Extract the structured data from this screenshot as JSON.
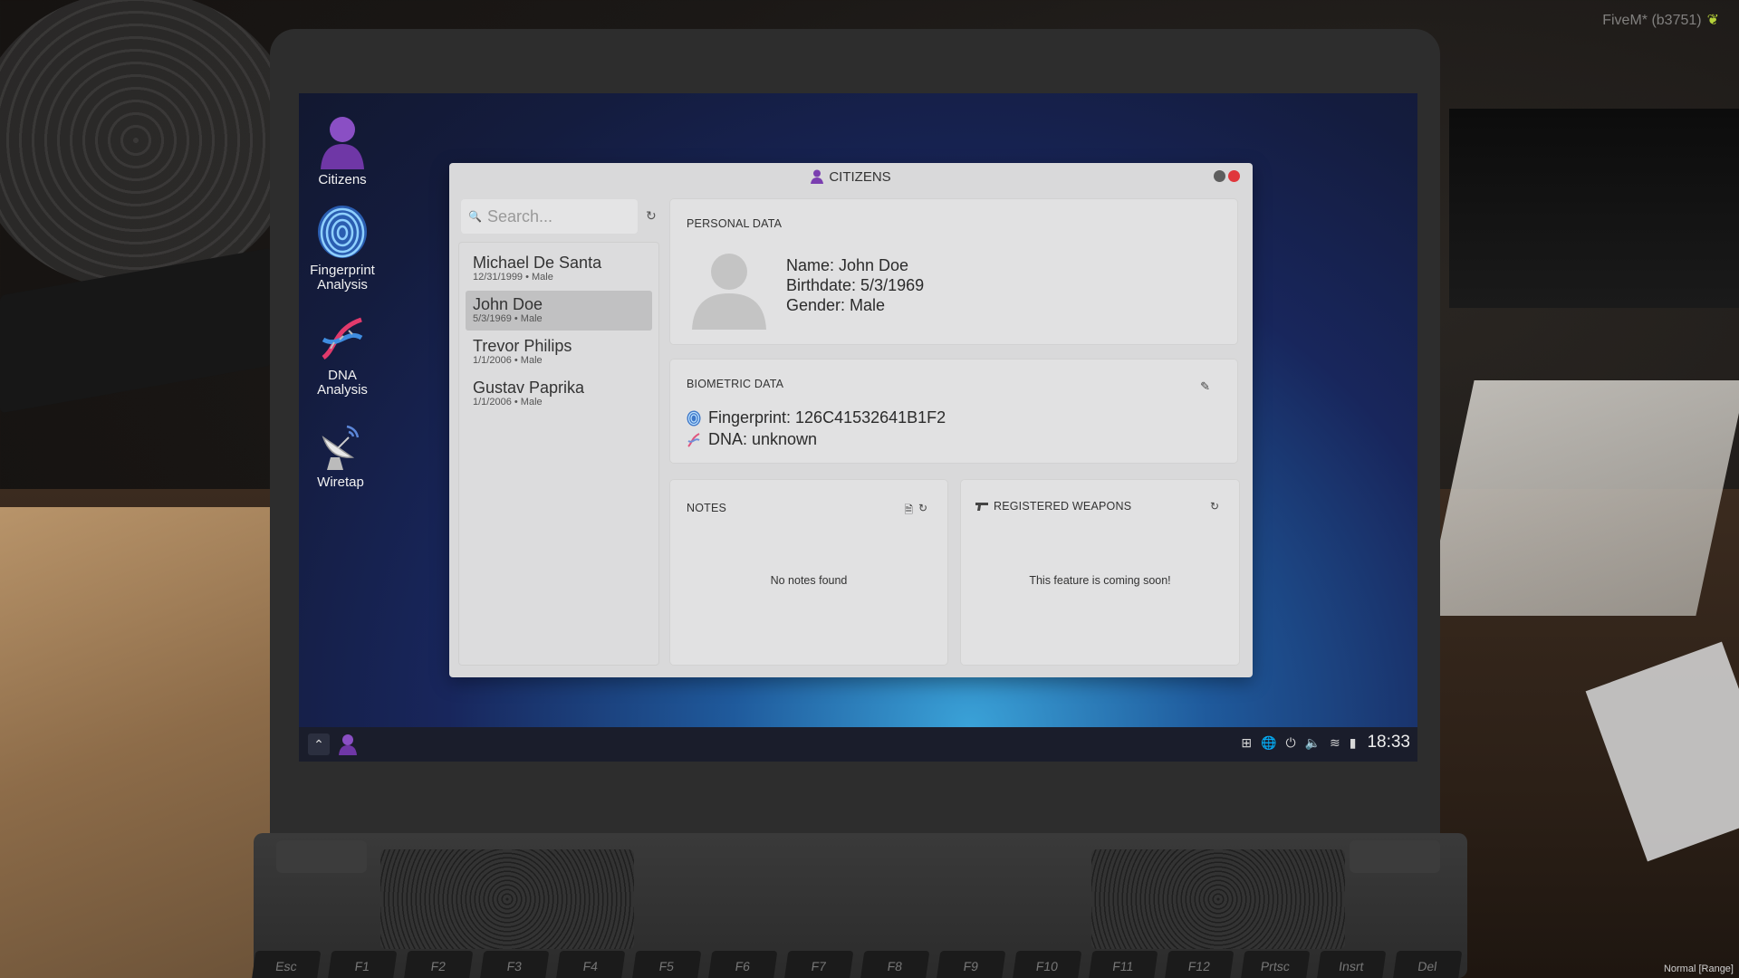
{
  "overlay": {
    "top_right": "FiveM* (b3751)",
    "bottom_right": "Normal [Range]"
  },
  "desktop": {
    "icons": [
      {
        "label": "Citizens",
        "icon": "person-icon"
      },
      {
        "label": "Fingerprint\nAnalysis",
        "icon": "fingerprint-icon"
      },
      {
        "label": "DNA\nAnalysis",
        "icon": "dna-icon"
      },
      {
        "label": "Wiretap",
        "icon": "satellite-dish-icon"
      }
    ]
  },
  "window": {
    "title": "CITIZENS",
    "search": {
      "placeholder": "Search..."
    },
    "citizens": [
      {
        "name": "Michael De Santa",
        "meta": "12/31/1999 • Male"
      },
      {
        "name": "John Doe",
        "meta": "5/3/1969 • Male",
        "selected": true
      },
      {
        "name": "Trevor Philips",
        "meta": "1/1/2006 • Male"
      },
      {
        "name": "Gustav Paprika",
        "meta": "1/1/2006 • Male"
      }
    ],
    "personal": {
      "title": "PERSONAL DATA",
      "name": "Name: John Doe",
      "birthdate": "Birthdate: 5/3/1969",
      "gender": "Gender: Male"
    },
    "biometric": {
      "title": "BIOMETRIC DATA",
      "fingerprint": "Fingerprint: 126C41532641B1F2",
      "dna": "DNA: unknown"
    },
    "notes": {
      "title": "NOTES",
      "empty": "No notes found"
    },
    "weapons": {
      "title": "REGISTERED WEAPONS",
      "empty": "This feature is coming soon!"
    }
  },
  "taskbar": {
    "clock": "18:33"
  },
  "keyboard": {
    "fkeys": [
      "Esc",
      "F1",
      "F2",
      "F3",
      "F4",
      "F5",
      "F6",
      "F7",
      "F8",
      "F9",
      "F10",
      "F11",
      "F12",
      "Prtsc",
      "Insrt",
      "Del"
    ]
  },
  "colors": {
    "window_bg": "#d9d9da",
    "close_button": "#e0373c",
    "accent_purple": "#7b3fb0",
    "taskbar_bg": "#1a1d2b"
  }
}
